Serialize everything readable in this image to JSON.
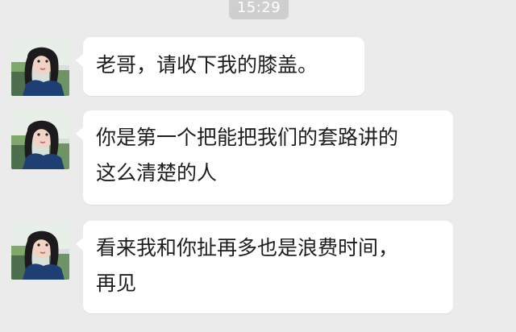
{
  "chat": {
    "timestamp": "15:29",
    "messages": [
      {
        "avatar": "girl-photo-icon",
        "text": "老哥，请收下我的膝盖。"
      },
      {
        "avatar": "girl-photo-icon",
        "text": "你是第一个把能把我们的套路讲的\n这么清楚的人"
      },
      {
        "avatar": "girl-photo-icon",
        "text": "看来我和你扯再多也是浪费时间，\n再见"
      }
    ]
  },
  "colors": {
    "background": "#ebebeb",
    "bubble": "#ffffff",
    "timestamp_bg": "#cfcfcf",
    "timestamp_text": "#ffffff",
    "message_text": "#1d1d1d"
  }
}
